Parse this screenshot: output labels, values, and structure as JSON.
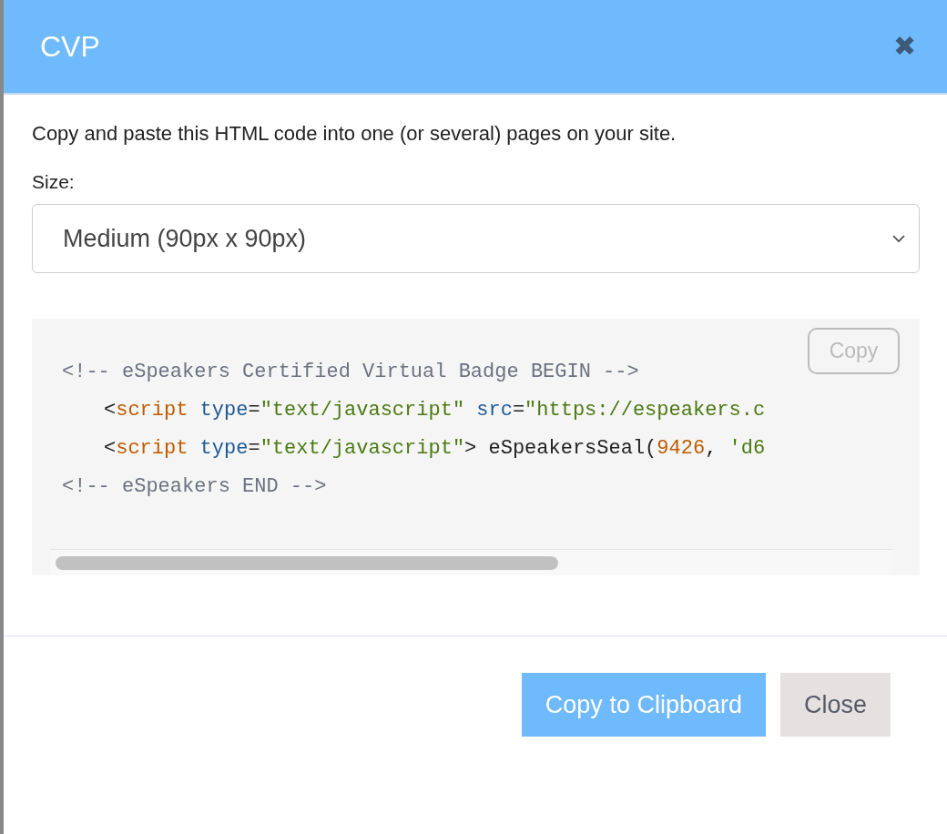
{
  "dialog": {
    "title": "CVP",
    "close_icon": "✖"
  },
  "intro": "Copy and paste this HTML code into one (or several) pages on your site.",
  "size": {
    "label": "Size:",
    "value": "Medium (90px x 90px)"
  },
  "code": {
    "copy_button": "Copy",
    "lines": [
      {
        "indented": false,
        "tokens": [
          {
            "kind": "comment",
            "text": "<!-- eSpeakers Certified Virtual Badge BEGIN -->"
          }
        ]
      },
      {
        "indented": true,
        "tokens": [
          {
            "kind": "punct",
            "text": "<"
          },
          {
            "kind": "tag",
            "text": "script"
          },
          {
            "kind": "attr",
            "text": " type"
          },
          {
            "kind": "punct",
            "text": "="
          },
          {
            "kind": "string",
            "text": "\"text/javascript\""
          },
          {
            "kind": "attr",
            "text": " src"
          },
          {
            "kind": "punct",
            "text": "="
          },
          {
            "kind": "string",
            "text": "\"https://espeakers.c"
          }
        ]
      },
      {
        "indented": true,
        "tokens": [
          {
            "kind": "punct",
            "text": "<"
          },
          {
            "kind": "tag",
            "text": "script"
          },
          {
            "kind": "attr",
            "text": " type"
          },
          {
            "kind": "punct",
            "text": "="
          },
          {
            "kind": "string",
            "text": "\"text/javascript\""
          },
          {
            "kind": "punct",
            "text": "> eSpeakersSeal("
          },
          {
            "kind": "number",
            "text": "9426"
          },
          {
            "kind": "punct",
            "text": ", "
          },
          {
            "kind": "string",
            "text": "'d6"
          }
        ]
      },
      {
        "indented": false,
        "tokens": [
          {
            "kind": "comment",
            "text": "<!-- eSpeakers END -->"
          }
        ]
      }
    ]
  },
  "buttons": [
    {
      "kind": "primary",
      "label": "Copy to Clipboard"
    },
    {
      "kind": "secondary",
      "label": "Close"
    }
  ]
}
